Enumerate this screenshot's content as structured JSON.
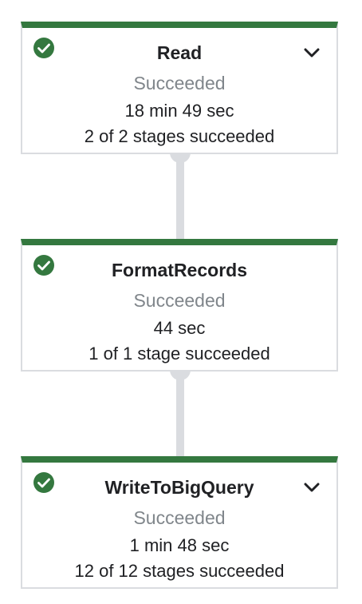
{
  "colors": {
    "success_bar": "#34783f",
    "success_icon": "#34783f",
    "connector": "#dadce0",
    "muted_text": "#80868b"
  },
  "nodes": [
    {
      "title": "Read",
      "status": "Succeeded",
      "duration": "18 min 49 sec",
      "stages": "2 of 2 stages succeeded",
      "status_icon": "check-circle-icon",
      "expandable": true
    },
    {
      "title": "FormatRecords",
      "status": "Succeeded",
      "duration": "44 sec",
      "stages": "1 of 1 stage succeeded",
      "status_icon": "check-circle-icon",
      "expandable": false
    },
    {
      "title": "WriteToBigQuery",
      "status": "Succeeded",
      "duration": "1 min 48 sec",
      "stages": "12 of 12 stages succeeded",
      "status_icon": "check-circle-icon",
      "expandable": true
    }
  ]
}
